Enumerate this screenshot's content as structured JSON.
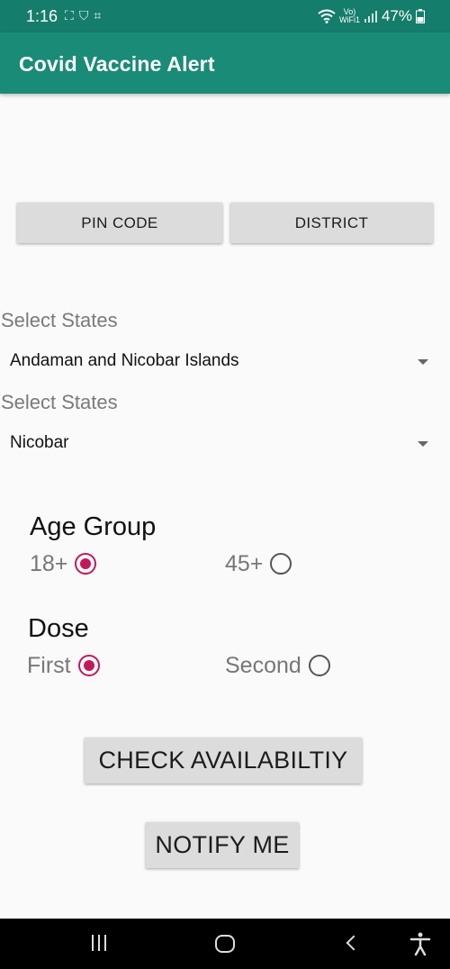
{
  "status_bar": {
    "time": "1:16",
    "network_top": "Vo)",
    "network_bottom": "WiFi1",
    "battery": "47%"
  },
  "app_bar": {
    "title": "Covid Vaccine Alert"
  },
  "mode_buttons": {
    "pin_code": "PIN CODE",
    "district": "DISTRICT"
  },
  "state_select": {
    "label": "Select States",
    "value": "Andaman and Nicobar Islands"
  },
  "district_select": {
    "label": "Select States",
    "value": "Nicobar"
  },
  "age_group": {
    "title": "Age Group",
    "options": [
      {
        "label": "18+",
        "checked": true
      },
      {
        "label": "45+",
        "checked": false
      }
    ]
  },
  "dose": {
    "title": "Dose",
    "options": [
      {
        "label": "First",
        "checked": true
      },
      {
        "label": "Second",
        "checked": false
      }
    ]
  },
  "actions": {
    "check": "CHECK AVAILABILTIY",
    "notify": "NOTIFY ME"
  },
  "colors": {
    "primary": "#1a8b76",
    "status": "#157d6b",
    "accent": "#c2185b"
  }
}
